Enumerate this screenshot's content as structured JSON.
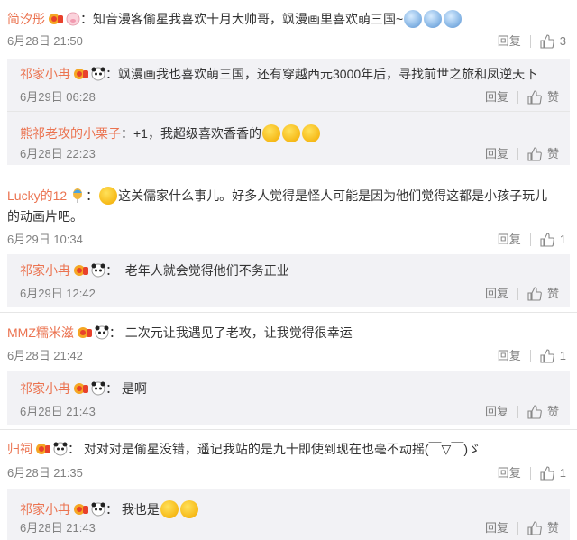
{
  "comments": [
    {
      "type": "root",
      "user": "简汐彤",
      "avatar": "pig-avatar",
      "text": "知音漫客偷星我喜欢十月大帅哥，飒漫画里喜欢萌三国~",
      "time": "6月28日 21:50",
      "reply_label": "回复",
      "likes": "3",
      "emojis": [
        "crying-face-emoji",
        "crying-face-emoji",
        "crying-face-emoji"
      ]
    },
    {
      "type": "reply",
      "user": "祁家小冉",
      "avatar": "panda-avatar",
      "text": "飒漫画我也喜欢萌三国，还有穿越西元3000年后，寻找前世之旅和凤逆天下",
      "time": "6月29日 06:28",
      "reply_label": "回复",
      "likes": "赞"
    },
    {
      "type": "reply",
      "user": "熊祁老攻的小栗子",
      "avatar": "",
      "text": "+1，我超级喜欢香香的",
      "time": "6月28日 22:23",
      "reply_label": "回复",
      "likes": "赞",
      "emojis": [
        "kiss-face-emoji",
        "kiss-face-emoji",
        "kiss-face-emoji"
      ]
    },
    {
      "type": "root",
      "user": "Lucky的12",
      "avatar": "balloon-avatar",
      "text": "这关儒家什么事儿。好多人觉得是怪人可能是因为他们觉得这都是小孩子玩儿",
      "text2": "的动画片吧。",
      "time": "6月29日 10:34",
      "reply_label": "回复",
      "likes": "1",
      "lead_emoji": "laughing-face-emoji"
    },
    {
      "type": "reply",
      "user": "祁家小冉",
      "avatar": "panda-avatar",
      "text": "老年人就会觉得他们不务正业",
      "time": "6月29日 12:42",
      "reply_label": "回复",
      "likes": "赞"
    },
    {
      "type": "root",
      "user": "MMZ糯米滋",
      "avatar": "panda-avatar",
      "text": "二次元让我遇见了老攻，让我觉得很幸运",
      "time": "6月28日 21:42",
      "reply_label": "回复",
      "likes": "1"
    },
    {
      "type": "reply",
      "user": "祁家小冉",
      "avatar": "panda-avatar",
      "text": "是啊",
      "time": "6月28日 21:43",
      "reply_label": "回复",
      "likes": "赞"
    },
    {
      "type": "root",
      "user": "归祠",
      "avatar": "panda-avatar",
      "text": "对对对是偷星没错，遥记我站的是九十即使到现在也毫不动摇(￣▽￣)ゞ",
      "time": "6月28日 21:35",
      "reply_label": "回复",
      "likes": "1"
    },
    {
      "type": "reply",
      "user": "祁家小冉",
      "avatar": "panda-avatar",
      "text": "我也是",
      "time": "6月28日 21:43",
      "reply_label": "回复",
      "likes": "赞",
      "emojis": [
        "shy-face-emoji",
        "shy-face-emoji"
      ]
    }
  ]
}
